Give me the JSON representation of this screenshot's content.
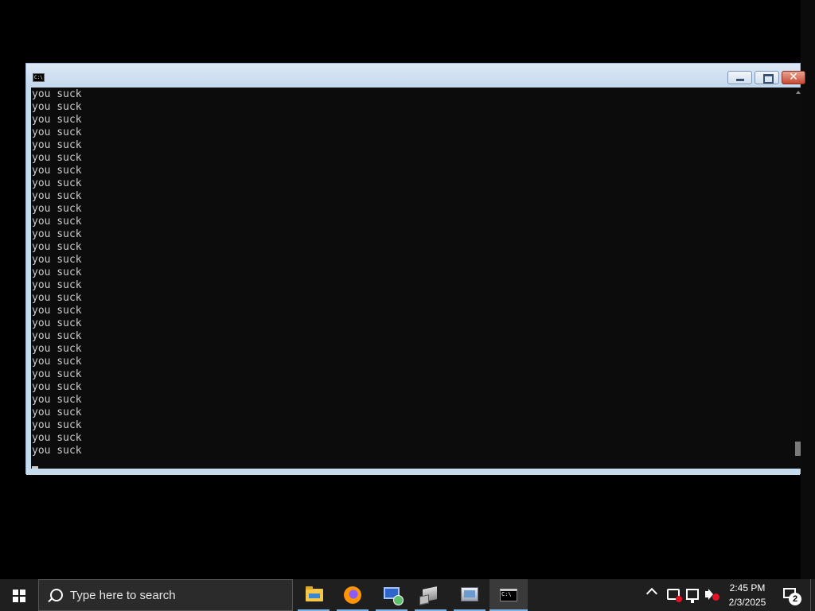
{
  "console": {
    "lines": [
      "you suck",
      "you suck",
      "you suck",
      "you suck",
      "you suck",
      "you suck",
      "you suck",
      "you suck",
      "you suck",
      "you suck",
      "you suck",
      "you suck",
      "you suck",
      "you suck",
      "you suck",
      "you suck",
      "you suck",
      "you suck",
      "you suck",
      "you suck",
      "you suck",
      "you suck",
      "you suck",
      "you suck",
      "you suck",
      "you suck",
      "you suck",
      "you suck",
      "you suck"
    ],
    "icon_glyph": "C:\\",
    "background": "#0c0c0c",
    "text_color": "#cccccc"
  },
  "window": {
    "icon": "cmd-icon",
    "close_glyph": "✕"
  },
  "taskbar": {
    "search_placeholder": "Type here to search",
    "apps": [
      {
        "name": "file-explorer",
        "icon": "folder-icon"
      },
      {
        "name": "firefox",
        "icon": "firefox-icon"
      },
      {
        "name": "this-pc",
        "icon": "computer-icon"
      },
      {
        "name": "network",
        "icon": "network-icon"
      },
      {
        "name": "devices",
        "icon": "devices-icon"
      },
      {
        "name": "command-prompt",
        "icon": "cmd-icon",
        "active": true
      }
    ],
    "clock": {
      "time": "2:45 PM",
      "date": "2/3/2025"
    },
    "notification_count": "2",
    "accent": "#7ab4e8"
  }
}
